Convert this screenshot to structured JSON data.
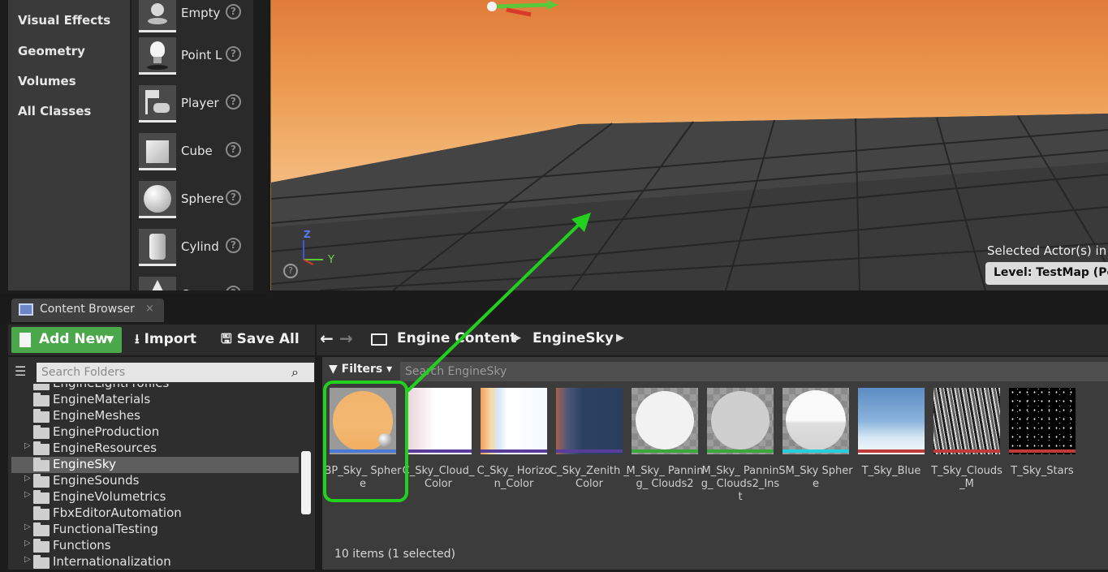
{
  "place_panel": {
    "categories": [
      "Visual Effects",
      "Geometry",
      "Volumes",
      "All Classes"
    ],
    "actors": [
      {
        "label": "Empty",
        "icon": "empty-actor-icon"
      },
      {
        "label": "Point L",
        "icon": "point-light-icon"
      },
      {
        "label": "Player",
        "icon": "player-start-icon"
      },
      {
        "label": "Cube",
        "icon": "cube-icon"
      },
      {
        "label": "Sphere",
        "icon": "sphere-icon"
      },
      {
        "label": "Cylind",
        "icon": "cylinder-icon"
      },
      {
        "label": "C",
        "icon": "cone-icon"
      }
    ],
    "help_glyph": "?"
  },
  "viewport": {
    "selected_actors_text": "Selected Actor(s) in:",
    "level_label": "Level:  TestMap (Pers",
    "axis_z": "Z",
    "axis_y": "Y",
    "help_glyph": "?"
  },
  "content_browser": {
    "tab_title": "Content Browser",
    "tab_close": "×",
    "toolbar": {
      "add_new": "Add New",
      "import": "Import",
      "save_all": "Save All"
    },
    "breadcrumb": [
      "Engine Content",
      "EngineSky"
    ],
    "folder_search_placeholder": "Search Folders",
    "asset_search_placeholder": "Search EngineSky",
    "filters_label": "Filters",
    "folders": [
      {
        "name": "EngineLightProfiles",
        "expandable": false,
        "selected": false
      },
      {
        "name": "EngineMaterials",
        "expandable": false,
        "selected": false
      },
      {
        "name": "EngineMeshes",
        "expandable": false,
        "selected": false
      },
      {
        "name": "EngineProduction",
        "expandable": false,
        "selected": false
      },
      {
        "name": "EngineResources",
        "expandable": true,
        "selected": false
      },
      {
        "name": "EngineSky",
        "expandable": false,
        "selected": true
      },
      {
        "name": "EngineSounds",
        "expandable": true,
        "selected": false
      },
      {
        "name": "EngineVolumetrics",
        "expandable": true,
        "selected": false
      },
      {
        "name": "FbxEditorAutomation",
        "expandable": false,
        "selected": false
      },
      {
        "name": "FunctionalTesting",
        "expandable": true,
        "selected": false
      },
      {
        "name": "Functions",
        "expandable": true,
        "selected": false
      },
      {
        "name": "Internationalization",
        "expandable": true,
        "selected": false
      }
    ],
    "assets": [
      {
        "name": "BP_Sky_ Sphere",
        "bar_color": "#4a7ad8"
      },
      {
        "name": "C_Sky_Cloud_ Color",
        "bar_color": "#5a3c9c"
      },
      {
        "name": "C_Sky_ Horizon_Color",
        "bar_color": "#5a3c9c"
      },
      {
        "name": "C_Sky_Zenith _Color",
        "bar_color": "#5a3c9c"
      },
      {
        "name": "M_Sky_ Panning_ Clouds2",
        "bar_color": "#3aa83a"
      },
      {
        "name": "M_Sky_ Panning_ Clouds2_Inst",
        "bar_color": "#3aa83a"
      },
      {
        "name": "SM_Sky Sphere",
        "bar_color": "#22d0e0"
      },
      {
        "name": "T_Sky_Blue",
        "bar_color": "#c03a3a"
      },
      {
        "name": "T_Sky_Clouds _M",
        "bar_color": "#c03a3a"
      },
      {
        "name": "T_Sky_Stars",
        "bar_color": "#c03a3a"
      }
    ],
    "status": "10 items (1 selected)"
  },
  "colors": {
    "add_new_green": "#4aa74a",
    "selection_outline": "#22d11e",
    "annotation_arrow": "#22d11e"
  }
}
